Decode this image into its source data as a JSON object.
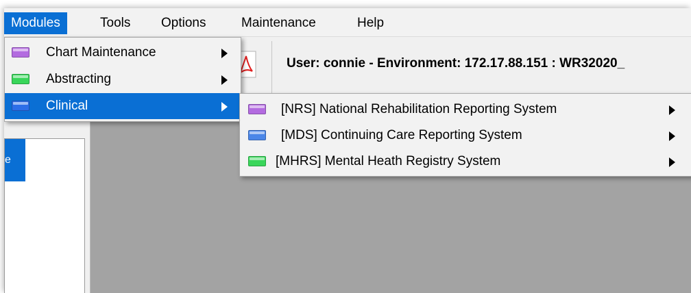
{
  "menubar": {
    "items": [
      {
        "label": "Modules",
        "active": true
      },
      {
        "label": "Tools"
      },
      {
        "label": "Options"
      },
      {
        "label": "Maintenance"
      },
      {
        "label": "Help"
      }
    ]
  },
  "toolbar": {
    "pdf_icon": "pdf-icon",
    "user_line": "User: connie -  Environment: 172.17.88.151 : WR32020_"
  },
  "left_panel": {
    "add_symbol": "+",
    "close_symbol": "✕",
    "selected_item_fragment": "e"
  },
  "modules_menu": {
    "items": [
      {
        "label": "Chart Maintenance",
        "icon": "purple-folder-icon",
        "color": "#b36be0",
        "has_submenu": true
      },
      {
        "label": "Abstracting",
        "icon": "green-folder-icon",
        "color": "#39d65a",
        "has_submenu": true
      },
      {
        "label": "Clinical",
        "icon": "blue-folder-icon",
        "color": "#2d6ee8",
        "has_submenu": true,
        "selected": true
      }
    ]
  },
  "clinical_submenu": {
    "items": [
      {
        "label": "[NRS] National Rehabilitation Reporting System",
        "icon": "purple-folder-icon",
        "color": "#b36be0",
        "has_submenu": true
      },
      {
        "label": "[MDS] Continuing Care Reporting System",
        "icon": "blue-folder-icon",
        "color": "#4a86e8",
        "has_submenu": true
      },
      {
        "label": "[MHRS] Mental Heath Registry System",
        "icon": "green-folder-icon",
        "color": "#39d65a",
        "has_submenu": true
      }
    ]
  },
  "colors": {
    "accent": "#0a6fd4",
    "workspace": "#a3a3a3"
  }
}
